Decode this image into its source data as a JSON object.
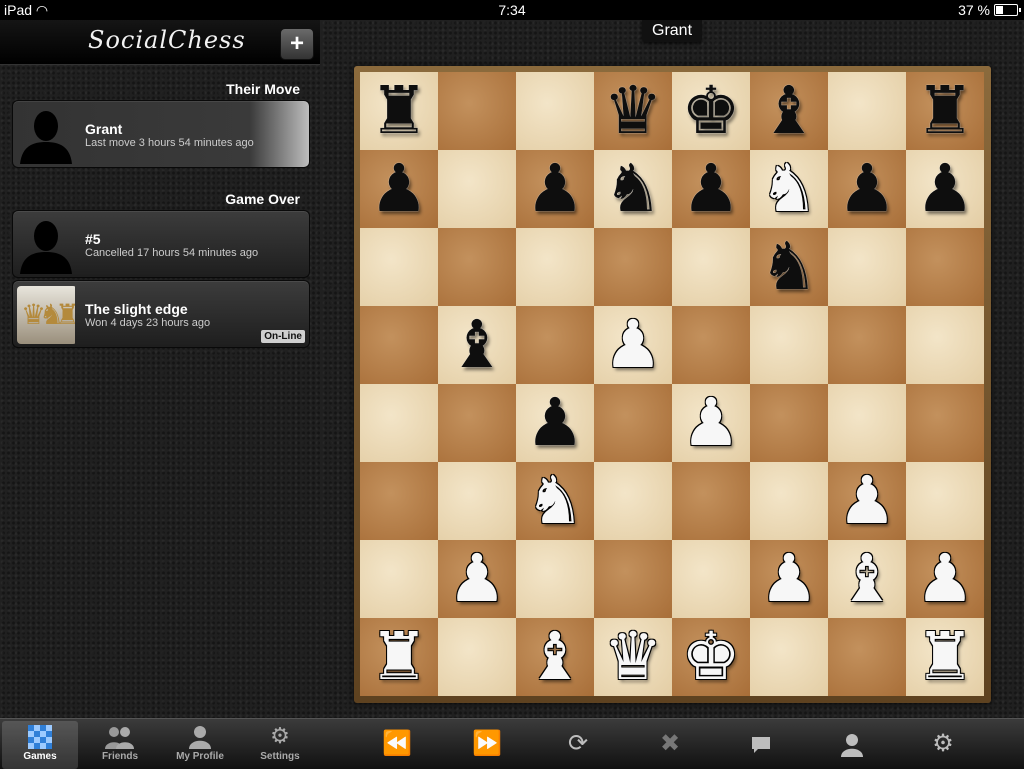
{
  "status_bar": {
    "device": "iPad",
    "time": "7:34",
    "battery": "37 %"
  },
  "sidebar": {
    "app_title": "SocialChess",
    "add_label": "+",
    "sections": [
      {
        "title": "Their Move",
        "games": [
          {
            "name": "Grant",
            "subtitle": "Last move 3 hours 54 minutes ago",
            "selected": true,
            "avatar": "silhouette-avatar"
          }
        ]
      },
      {
        "title": "Game Over",
        "games": [
          {
            "name": "#5",
            "subtitle": "Cancelled 17 hours 54 minutes ago",
            "avatar": "silhouette-avatar"
          },
          {
            "name": "The slight edge",
            "subtitle": "Won 4 days 23 hours ago",
            "badge": "On-Line",
            "avatar": "chess-pieces-photo"
          }
        ]
      }
    ]
  },
  "game": {
    "opponent": "Grant",
    "board": [
      [
        "br",
        "",
        "",
        "bq",
        "bk",
        "bb",
        "",
        "br"
      ],
      [
        "bp",
        "",
        "bp",
        "bn",
        "bp",
        "wn",
        "bp",
        "bp"
      ],
      [
        "",
        "",
        "",
        "",
        "",
        "bn",
        "",
        ""
      ],
      [
        "",
        "bb",
        "",
        "wp",
        "",
        "",
        "",
        ""
      ],
      [
        "",
        "",
        "bp",
        "",
        "wp",
        "",
        "",
        ""
      ],
      [
        "",
        "",
        "wn",
        "",
        "",
        "",
        "wp",
        ""
      ],
      [
        "",
        "wp",
        "",
        "",
        "",
        "wp",
        "wb",
        "wp"
      ],
      [
        "wr",
        "",
        "wb",
        "wq",
        "wk",
        "",
        "",
        "wr"
      ]
    ]
  },
  "tabbar": {
    "tabs": [
      {
        "label": "Games",
        "icon": "checkerboard-icon",
        "active": true
      },
      {
        "label": "Friends",
        "icon": "people-icon"
      },
      {
        "label": "My Profile",
        "icon": "person-icon"
      },
      {
        "label": "Settings",
        "icon": "gear-icon"
      }
    ],
    "tools": [
      "rewind-icon",
      "fast-forward-icon",
      "refresh-icon",
      "close-icon",
      "chat-icon",
      "player-icon",
      "gear-icon"
    ]
  }
}
